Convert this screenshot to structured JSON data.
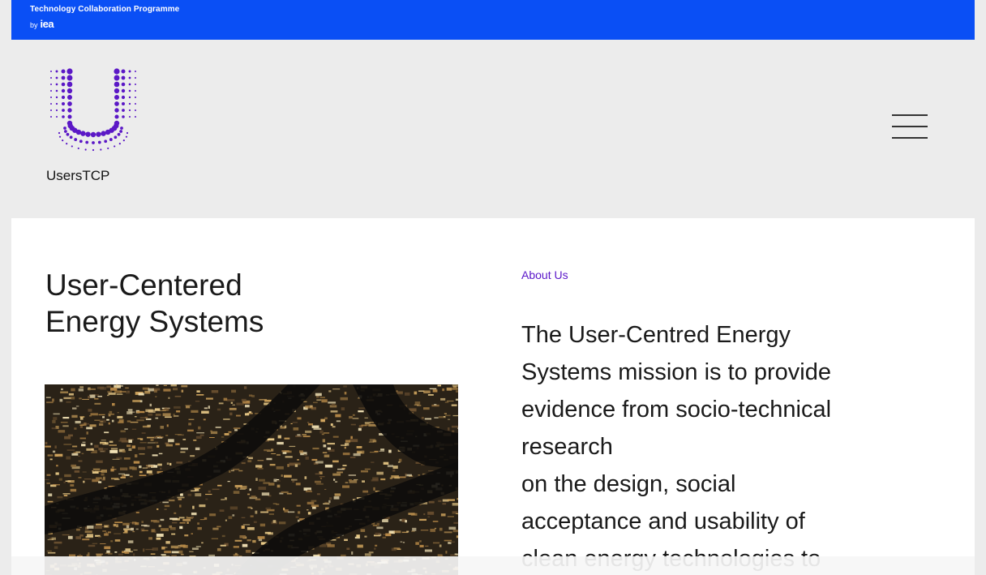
{
  "topbar": {
    "programme": "Technology Collaboration Programme",
    "by": "by",
    "org": "iea"
  },
  "header": {
    "brand": "UsersTCP",
    "menu_icon": "hamburger-menu-icon",
    "logo_color": "#5b18c6"
  },
  "main": {
    "title_line1": "User-Centered",
    "title_line2": "Energy Systems",
    "about_label": "About Us",
    "mission_lines": [
      "The User-Centred Energy",
      "Systems mission is to provide",
      "evidence from socio-technical",
      "research",
      "on the design, social",
      "acceptance and usability of",
      "clean energy technologies to"
    ]
  },
  "colors": {
    "topbar": "#0a4ff5",
    "header_bg": "#ececec",
    "accent": "#5a16c9"
  }
}
